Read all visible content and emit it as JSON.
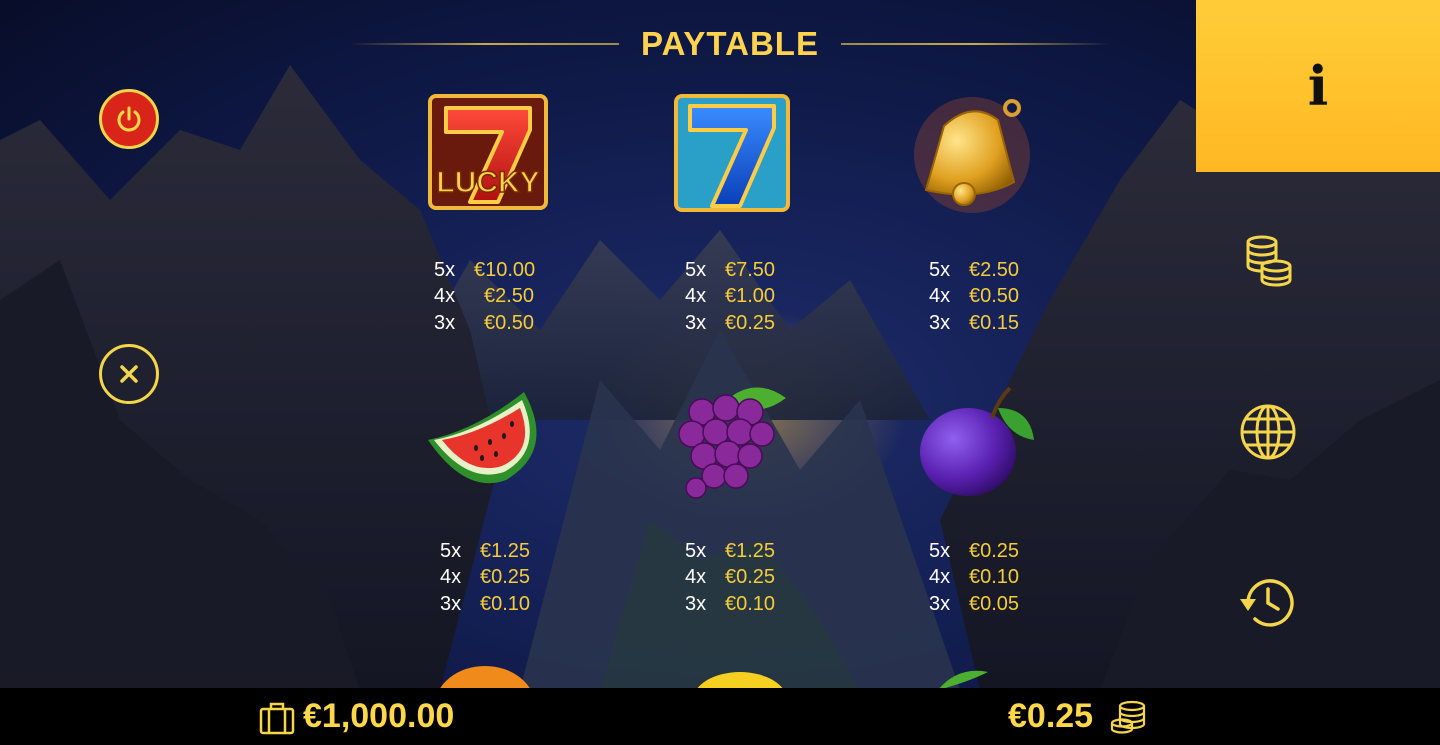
{
  "title": "PAYTABLE",
  "symbols": [
    {
      "name": "lucky-seven",
      "pays": [
        {
          "count": "5x",
          "amount": "€10.00"
        },
        {
          "count": "4x",
          "amount": "€2.50"
        },
        {
          "count": "3x",
          "amount": "€0.50"
        }
      ]
    },
    {
      "name": "blue-seven",
      "pays": [
        {
          "count": "5x",
          "amount": "€7.50"
        },
        {
          "count": "4x",
          "amount": "€1.00"
        },
        {
          "count": "3x",
          "amount": "€0.25"
        }
      ]
    },
    {
      "name": "bell",
      "pays": [
        {
          "count": "5x",
          "amount": "€2.50"
        },
        {
          "count": "4x",
          "amount": "€0.50"
        },
        {
          "count": "3x",
          "amount": "€0.15"
        }
      ]
    },
    {
      "name": "watermelon",
      "pays": [
        {
          "count": "5x",
          "amount": "€1.25"
        },
        {
          "count": "4x",
          "amount": "€0.25"
        },
        {
          "count": "3x",
          "amount": "€0.10"
        }
      ]
    },
    {
      "name": "grapes",
      "pays": [
        {
          "count": "5x",
          "amount": "€1.25"
        },
        {
          "count": "4x",
          "amount": "€0.25"
        },
        {
          "count": "3x",
          "amount": "€0.10"
        }
      ]
    },
    {
      "name": "plum",
      "pays": [
        {
          "count": "5x",
          "amount": "€0.25"
        },
        {
          "count": "4x",
          "amount": "€0.10"
        },
        {
          "count": "3x",
          "amount": "€0.05"
        }
      ]
    }
  ],
  "lucky_label": "LUCKY",
  "info_glyph": "i",
  "footer": {
    "balance": "€1,000.00",
    "bet": "€0.25"
  },
  "icons": {
    "left": [
      "power-icon",
      "close-icon"
    ],
    "right": [
      "info-icon",
      "coins-icon",
      "globe-icon",
      "history-icon"
    ],
    "footer": [
      "wallet-icon",
      "coin-stack-icon"
    ]
  },
  "colors": {
    "accent": "#ffd34d",
    "info_tab": "#ffc22f",
    "power_red": "#d9241a"
  }
}
